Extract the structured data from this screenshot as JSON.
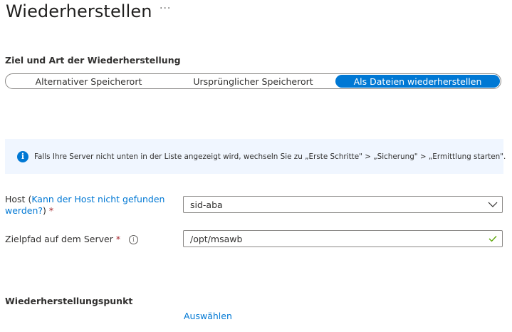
{
  "header": {
    "title": "Wiederherstellen",
    "more_label": "···"
  },
  "restore_target": {
    "heading": "Ziel und Art der Wiederherstellung",
    "options": [
      {
        "label": "Alternativer Speicherort",
        "selected": false
      },
      {
        "label": "Ursprünglicher Speicherort",
        "selected": false
      },
      {
        "label": "Als Dateien wiederherstellen",
        "selected": true
      }
    ]
  },
  "info_banner": {
    "icon": "info-icon",
    "text": "Falls Ihre Server nicht unten in der Liste angezeigt wird, wechseln Sie zu „Erste Schritte\" > „Sicherung\" > „Ermittlung starten\"."
  },
  "form": {
    "host": {
      "label": "Host",
      "link_text": "Kann der Host nicht gefunden werden?",
      "value": "sid-aba",
      "required_mark": "*"
    },
    "target_path": {
      "label": "Zielpfad auf dem Server",
      "required_mark": "*",
      "value": "/opt/msawb"
    }
  },
  "restore_point": {
    "heading": "Wiederherstellungspunkt",
    "select_link": "Auswählen"
  },
  "colors": {
    "accent": "#0078d4",
    "required": "#a4262c",
    "success": "#57a300",
    "banner_bg": "#f0f6ff"
  }
}
